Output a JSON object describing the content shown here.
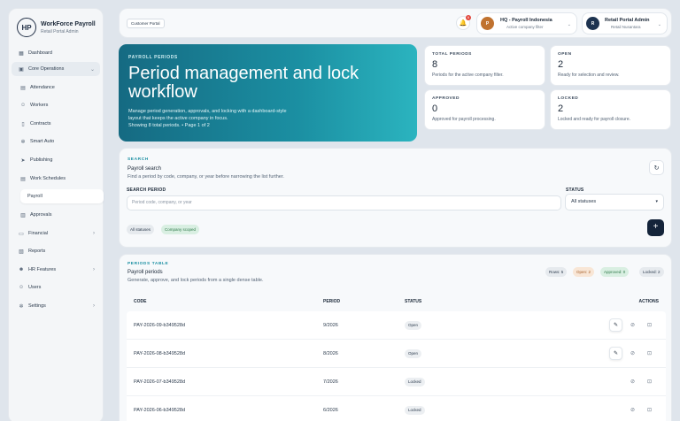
{
  "sidebar": {
    "app_name": "WorkForce Payroll",
    "app_sub": "Retail Portal Admin",
    "logo": "HP",
    "items": [
      {
        "label": "Dashboard",
        "icon": "grid-icon"
      },
      {
        "label": "Core Operations",
        "icon": "briefcase-icon"
      },
      {
        "label": "Attendance",
        "icon": "calendar-icon"
      },
      {
        "label": "Workers",
        "icon": "users-icon"
      },
      {
        "label": "Contracts",
        "icon": "document-icon"
      },
      {
        "label": "Smart Auto",
        "icon": "gear-icon"
      },
      {
        "label": "Publishing",
        "icon": "send-icon"
      },
      {
        "label": "Work Schedules",
        "icon": "calendar-icon"
      },
      {
        "label": "Payroll",
        "icon": ""
      },
      {
        "label": "Approvals",
        "icon": "check-icon"
      },
      {
        "label": "Financial",
        "icon": "money-icon"
      },
      {
        "label": "Reports",
        "icon": "report-icon"
      },
      {
        "label": "HR Features",
        "icon": "people-icon"
      },
      {
        "label": "Users",
        "icon": "user-icon"
      },
      {
        "label": "Settings",
        "icon": "gear-icon"
      }
    ]
  },
  "topbar": {
    "portal_chip": "Customer Portal",
    "notif_count": "6",
    "tenant_initial": "P",
    "tenant_name": "HQ - Payroll Indonesia",
    "tenant_sub": "Active company filter",
    "user_initial": "R",
    "user_name": "Retail Portal Admin",
    "user_sub": "Retail Nusantara"
  },
  "hero": {
    "eyebrow": "PAYROLL PERIODS",
    "title": "Period management and lock workflow",
    "desc": "Manage period generation, approvals, and locking with a dashboard-style layout that keeps the active company in focus.",
    "meta": "Showing 8 total periods. • Page 1 of 2"
  },
  "stats": [
    {
      "label": "TOTAL PERIODS",
      "value": "8",
      "hint": "Periods for the active company filter."
    },
    {
      "label": "OPEN",
      "value": "2",
      "hint": "Ready for selection and review."
    },
    {
      "label": "APPROVED",
      "value": "0",
      "hint": "Approved for payroll processing."
    },
    {
      "label": "LOCKED",
      "value": "2",
      "hint": "Locked and ready for payroll closure."
    }
  ],
  "search": {
    "eyebrow": "SEARCH",
    "title": "Payroll search",
    "desc": "Find a period by code, company, or year before narrowing the list further.",
    "period_label": "SEARCH PERIOD",
    "placeholder": "Period code, company, or year",
    "status_label": "STATUS",
    "status_value": "All statuses",
    "pill_all": "All statuses",
    "pill_company": "Company scoped",
    "add": "+"
  },
  "table": {
    "eyebrow": "PERIODS TABLE",
    "title": "Payroll periods",
    "desc": "Generate, approve, and lock periods from a single dense table.",
    "badges": {
      "rows": "Rows: 5",
      "open": "Open: 2",
      "approved": "Approved: 0",
      "locked": "Locked: 2"
    },
    "headers": {
      "code": "CODE",
      "period": "PERIOD",
      "status": "STATUS",
      "actions": "ACTIONS"
    },
    "rows": [
      {
        "code": "PAY-2026-09-b349528d",
        "period": "9/2026",
        "status": "Open"
      },
      {
        "code": "PAY-2026-08-b349528d",
        "period": "8/2026",
        "status": "Open"
      },
      {
        "code": "PAY-2026-07-b349528d",
        "period": "7/2026",
        "status": "Locked"
      },
      {
        "code": "PAY-2026-06-b349528d",
        "period": "6/2026",
        "status": "Locked"
      }
    ]
  },
  "colors": {
    "accent": "#1b8fa2",
    "dark": "#14243a",
    "open_badge": "#f8e6d6",
    "approved_badge": "#d9efe2"
  }
}
